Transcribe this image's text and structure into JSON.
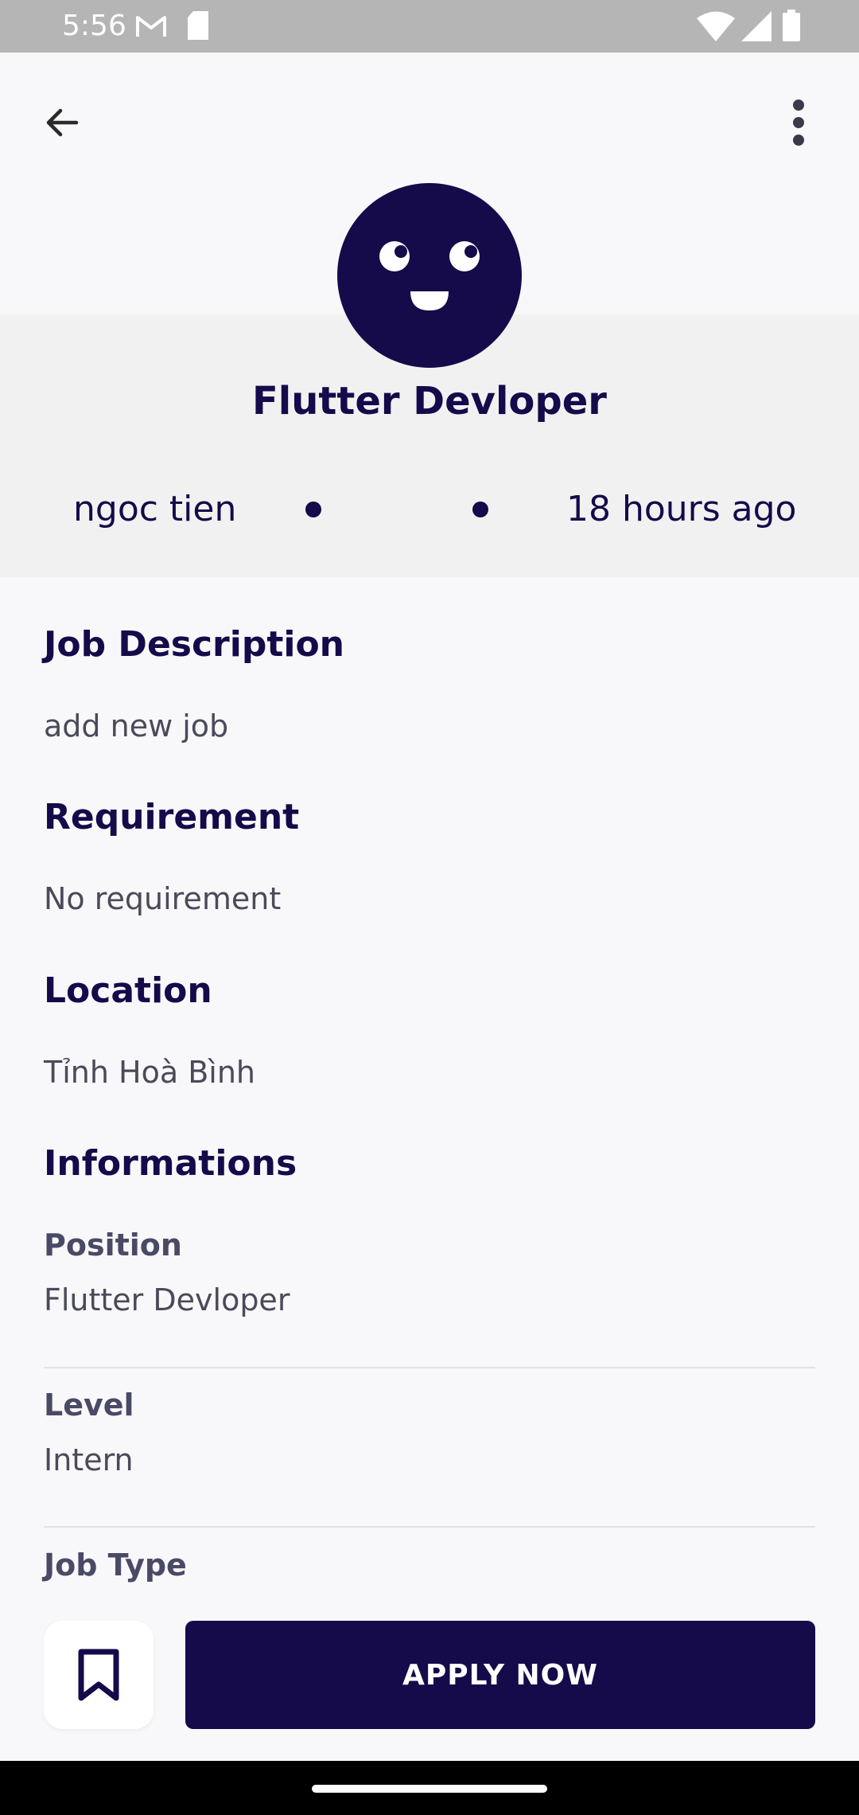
{
  "status_bar": {
    "time": "5:56",
    "icons": [
      "gmail-icon",
      "sd-card-icon",
      "wifi-icon",
      "signal-icon",
      "battery-icon"
    ]
  },
  "header": {
    "back_icon": "arrow-back-icon",
    "more_icon": "more-vertical-icon"
  },
  "job": {
    "title": "Flutter Devloper",
    "poster": "ngoc tien",
    "posted_time": "18 hours ago"
  },
  "sections": {
    "description_title": "Job Description",
    "description_text": "add new job",
    "requirement_title": "Requirement",
    "requirement_text": "No requirement",
    "location_title": "Location",
    "location_text": "Tỉnh Hoà Bình",
    "informations_title": "Informations"
  },
  "informations": {
    "position_label": "Position",
    "position_value": "Flutter Devloper",
    "level_label": "Level",
    "level_value": "Intern",
    "job_type_label": "Job Type"
  },
  "actions": {
    "bookmark_icon": "bookmark-icon",
    "apply_label": "APPLY NOW"
  },
  "colors": {
    "primary": "#150a4a",
    "background": "#f8f8fa",
    "band": "#f1f1f1"
  }
}
